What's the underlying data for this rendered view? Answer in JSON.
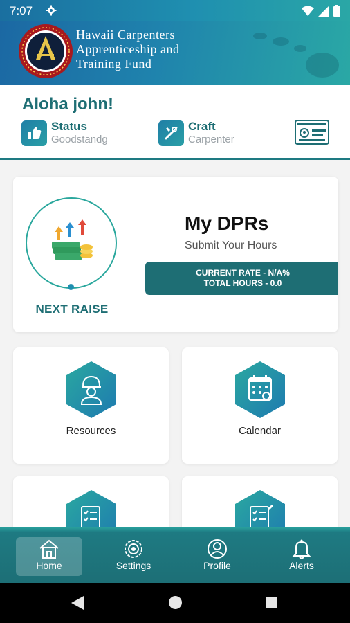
{
  "status_bar": {
    "time": "7:07"
  },
  "header": {
    "org_line1": "Hawaii Carpenters",
    "org_line2": "Apprenticeship and",
    "org_line3": "Training Fund"
  },
  "greeting": {
    "text": "Aloha john!",
    "status_label": "Status",
    "status_value": "Goodstandg",
    "craft_label": "Craft",
    "craft_value": "Carpenter"
  },
  "dpr": {
    "next_raise_label": "NEXT RAISE",
    "title": "My DPRs",
    "subtitle": "Submit Your Hours",
    "current_rate": "CURRENT RATE - N/A%",
    "total_hours": "TOTAL HOURS - 0.0"
  },
  "tiles": [
    {
      "label": "Resources",
      "icon": "worker-icon"
    },
    {
      "label": "Calendar",
      "icon": "calendar-icon"
    },
    {
      "label": "",
      "icon": "checklist-icon"
    },
    {
      "label": "",
      "icon": "checklist-icon"
    }
  ],
  "bottom_nav": [
    {
      "label": "Home",
      "icon": "house-icon",
      "active": true
    },
    {
      "label": "Settings",
      "icon": "settings-icon",
      "active": false
    },
    {
      "label": "Profile",
      "icon": "profile-icon",
      "active": false
    },
    {
      "label": "Alerts",
      "icon": "bell-icon",
      "active": false
    }
  ],
  "colors": {
    "primary": "#1e6e74",
    "accent": "#2aa79d",
    "header_start": "#1b68a3",
    "header_end": "#2aa8a5"
  }
}
